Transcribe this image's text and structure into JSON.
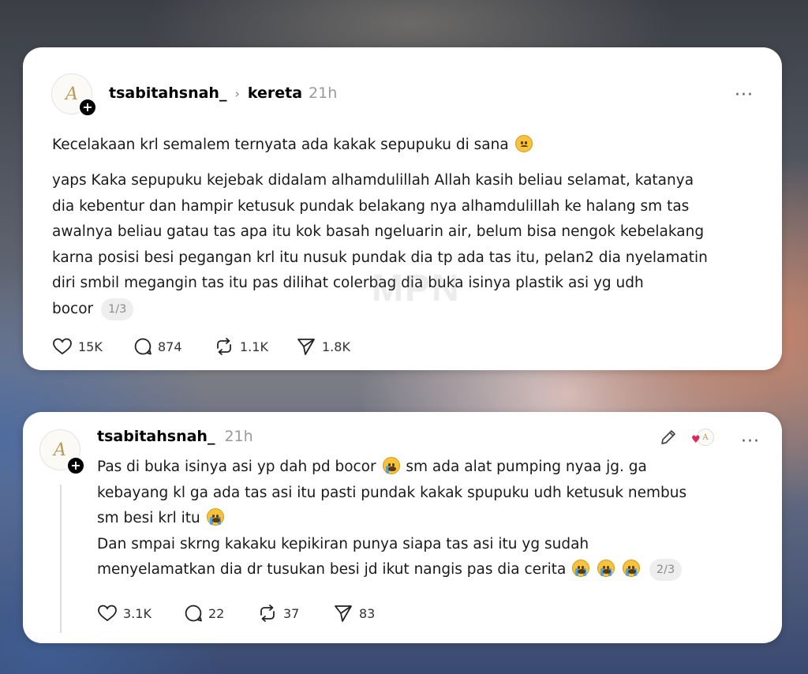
{
  "posts": [
    {
      "username": "tsabitahsnah_",
      "topic": "kereta",
      "time": "21h",
      "avatar_mark": "A",
      "paragraph1": "Kecelakaan krl semalem ternyata ada kakak sepupuku di sana",
      "paragraph2_lines": [
        "yaps Kaka sepupuku kejebak didalam alhamdulillah Allah kasih beliau selamat, katanya",
        "dia kebentur dan hampir ketusuk pundak belakang nya alhamdulillah ke halang sm tas",
        "awalnya beliau gatau tas apa itu kok basah ngeluarin air, belum bisa nengok kebelakang",
        "karna posisi besi pegangan krl itu nusuk pundak dia tp ada tas itu, pelan2 dia nyelamatin",
        "diri smbil megangin tas itu pas dilihat colerbag dia buka isinya plastik asi yg udh",
        "bocor"
      ],
      "pager": "1/3",
      "likes": "15K",
      "comments": "874",
      "reposts": "1.1K",
      "shares": "1.8K"
    },
    {
      "username": "tsabitahsnah_",
      "time": "21h",
      "avatar_mark": "A",
      "lines": [
        "Pas di buka isinya asi yp dah pd bocor",
        "sm ada alat pumping nyaa jg. ga",
        "kebayang kl ga ada tas asi itu pasti pundak kakak spupuku udh ketusuk nembus",
        "sm besi krl itu",
        "Dan smpai skrng kakaku kepikiran punya siapa tas asi itu yg sudah",
        "menyelamatkan dia dr tusukan besi jd ikut nangis pas dia cerita"
      ],
      "pager": "2/3",
      "likes": "3.1K",
      "comments": "22",
      "reposts": "37",
      "shares": "83"
    }
  ],
  "watermark": "MPN",
  "icons": {
    "more": "more-icon",
    "like": "heart-icon",
    "comment": "comment-icon",
    "repost": "repost-icon",
    "share": "share-icon",
    "edit": "pencil-icon"
  }
}
